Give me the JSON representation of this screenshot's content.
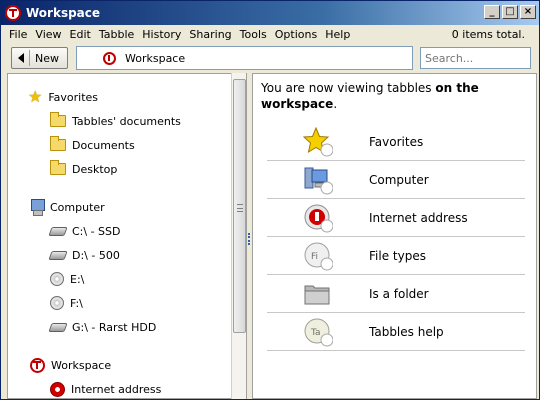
{
  "window": {
    "title": "Workspace"
  },
  "window_controls": {
    "minimize": "_",
    "maximize": "□",
    "close": "×"
  },
  "menu": [
    "File",
    "View",
    "Edit",
    "Tabble",
    "History",
    "Sharing",
    "Tools",
    "Options",
    "Help"
  ],
  "status": {
    "items_total": "0 items total."
  },
  "toolbar": {
    "new_label": "New",
    "address_text": "Workspace",
    "search_placeholder": "Search..."
  },
  "sidebar": {
    "favorites": {
      "label": "Favorites",
      "items": [
        "Tabbles' documents",
        "Documents",
        "Desktop"
      ]
    },
    "computer": {
      "label": "Computer",
      "drives": [
        "C:\\ - SSD",
        "D:\\ - 500",
        "E:\\",
        "F:\\",
        "G:\\ - Rarst HDD"
      ]
    },
    "workspace": {
      "label": "Workspace",
      "items": [
        "Internet address"
      ]
    }
  },
  "main": {
    "info_prefix": "You are now viewing tabbles ",
    "info_bold": "on the workspace",
    "info_suffix": ".",
    "commands": [
      {
        "label": "Favorites",
        "icon": "star-icon"
      },
      {
        "label": "Computer",
        "icon": "computer-icon"
      },
      {
        "label": "Internet address",
        "icon": "internet-icon"
      },
      {
        "label": "File types",
        "icon": "filetypes-icon",
        "icon_text": "Fi"
      },
      {
        "label": "Is a folder",
        "icon": "folder-icon"
      },
      {
        "label": "Tabbles help",
        "icon": "help-icon",
        "icon_text": "Ta"
      }
    ]
  },
  "colors": {
    "titlebar_start": "#0a246a",
    "accent_red": "#c00000",
    "folder": "#f5d96b"
  }
}
